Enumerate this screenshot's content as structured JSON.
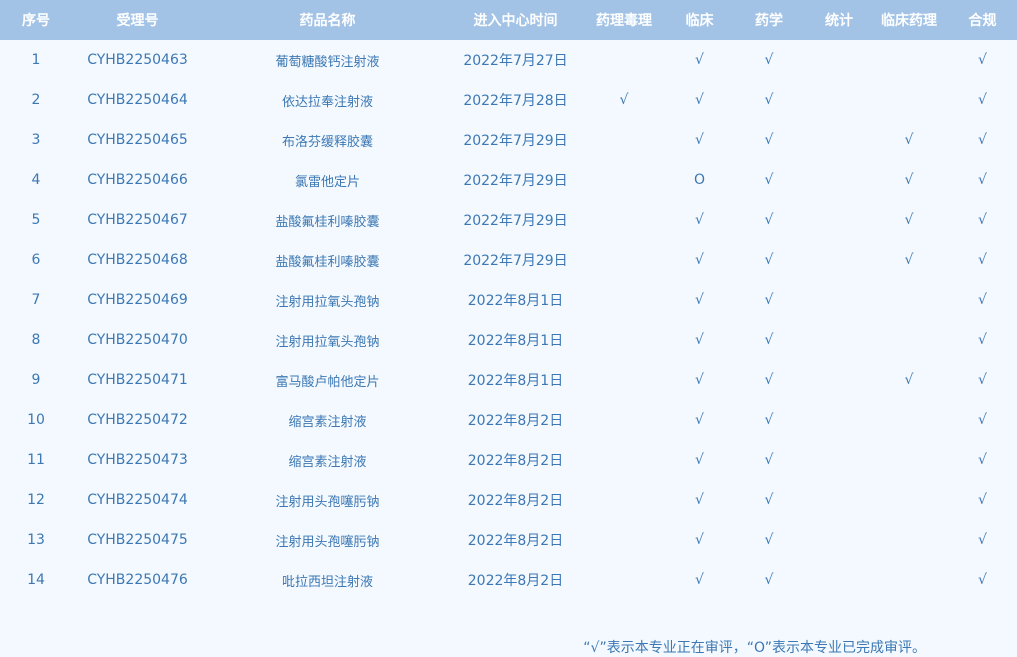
{
  "table": {
    "headers": [
      "序号",
      "受理号",
      "药品名称",
      "进入中心时间",
      "药理毒理",
      "临床",
      "药学",
      "统计",
      "临床药理",
      "合规"
    ],
    "rows": [
      [
        "1",
        "CYHB2250463",
        "葡萄糖酸钙注射液",
        "2022年7月27日",
        "",
        "√",
        "√",
        "",
        "",
        "√"
      ],
      [
        "2",
        "CYHB2250464",
        "依达拉奉注射液",
        "2022年7月28日",
        "√",
        "√",
        "√",
        "",
        "",
        "√"
      ],
      [
        "3",
        "CYHB2250465",
        "布洛芬缓释胶囊",
        "2022年7月29日",
        "",
        "√",
        "√",
        "",
        "√",
        "√"
      ],
      [
        "4",
        "CYHB2250466",
        "氯雷他定片",
        "2022年7月29日",
        "",
        "O",
        "√",
        "",
        "√",
        "√"
      ],
      [
        "5",
        "CYHB2250467",
        "盐酸氟桂利嗪胶囊",
        "2022年7月29日",
        "",
        "√",
        "√",
        "",
        "√",
        "√"
      ],
      [
        "6",
        "CYHB2250468",
        "盐酸氟桂利嗪胶囊",
        "2022年7月29日",
        "",
        "√",
        "√",
        "",
        "√",
        "√"
      ],
      [
        "7",
        "CYHB2250469",
        "注射用拉氧头孢钠",
        "2022年8月1日",
        "",
        "√",
        "√",
        "",
        "",
        "√"
      ],
      [
        "8",
        "CYHB2250470",
        "注射用拉氧头孢钠",
        "2022年8月1日",
        "",
        "√",
        "√",
        "",
        "",
        "√"
      ],
      [
        "9",
        "CYHB2250471",
        "富马酸卢帕他定片",
        "2022年8月1日",
        "",
        "√",
        "√",
        "",
        "√",
        "√"
      ],
      [
        "10",
        "CYHB2250472",
        "缩宫素注射液",
        "2022年8月2日",
        "",
        "√",
        "√",
        "",
        "",
        "√"
      ],
      [
        "11",
        "CYHB2250473",
        "缩宫素注射液",
        "2022年8月2日",
        "",
        "√",
        "√",
        "",
        "",
        "√"
      ],
      [
        "12",
        "CYHB2250474",
        "注射用头孢噻肟钠",
        "2022年8月2日",
        "",
        "√",
        "√",
        "",
        "",
        "√"
      ],
      [
        "13",
        "CYHB2250475",
        "注射用头孢噻肟钠",
        "2022年8月2日",
        "",
        "√",
        "√",
        "",
        "",
        "√"
      ],
      [
        "14",
        "CYHB2250476",
        "吡拉西坦注射液",
        "2022年8月2日",
        "",
        "√",
        "√",
        "",
        "",
        "√"
      ]
    ]
  },
  "footnote": "“√”表示本专业正在审评，“O”表示本专业已完成审评。",
  "colors": {
    "header_bg": "#a3c3e6",
    "header_text": "#ffffff",
    "body_bg": "#f3f9fe",
    "body_text": "#3d78b4"
  }
}
